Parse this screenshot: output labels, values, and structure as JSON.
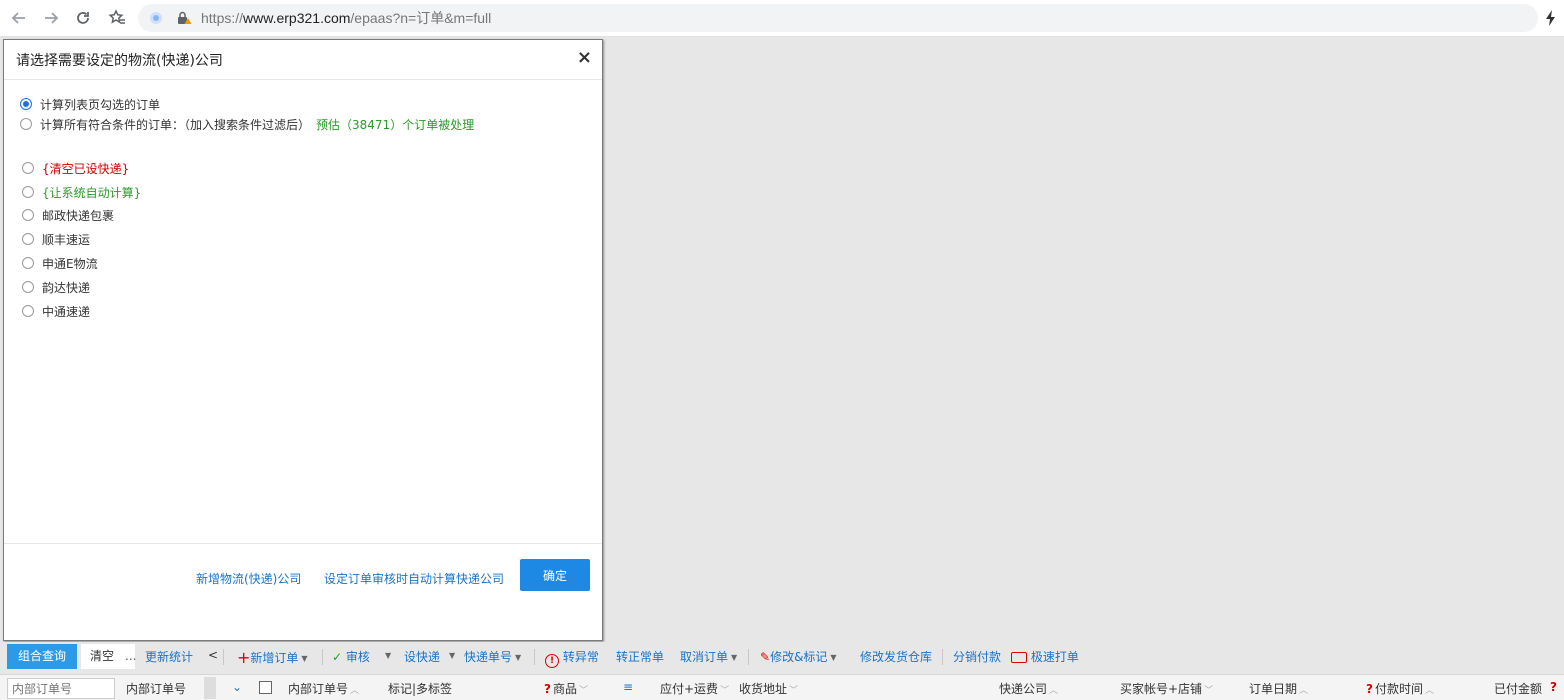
{
  "browser": {
    "url_prefix": "https://",
    "url_domain": "www.erp321.com",
    "url_path": "/epaas?n=订单&m=full"
  },
  "modal": {
    "title": "请选择需要设定的物流(快递)公司",
    "close_label": "×",
    "scope_options": [
      {
        "label": "计算列表页勾选的订单",
        "checked": true
      },
      {
        "label": "计算所有符合条件的订单：（加入搜索条件过滤后）",
        "hint": "预估（38471）个订单被处理",
        "checked": false
      }
    ],
    "carriers": [
      {
        "label": "{清空已设快递}",
        "color": "#d00000"
      },
      {
        "label": "{让系统自动计算}",
        "color": "#2a9b2a"
      },
      {
        "label": "邮政快递包裹"
      },
      {
        "label": "顺丰速运"
      },
      {
        "label": "申通E物流"
      },
      {
        "label": "韵达快递"
      },
      {
        "label": "中通速递"
      }
    ],
    "footer": {
      "add_carrier_link": "新增物流(快递)公司",
      "auto_calc_link": "设定订单审核时自动计算快递公司",
      "confirm_label": "确定"
    }
  },
  "toolbar": {
    "combo_query": "组合查询",
    "clear": "清空",
    "more": "...",
    "update_stats": "更新统计",
    "collapse": "<",
    "new_order": "新增订单",
    "review": "审核",
    "set_express": "设快递",
    "tracking_no": "快递单号",
    "to_abnormal": "转异常",
    "to_normal": "转正常单",
    "cancel_order": "取消订单",
    "modify_mark": "修改&标记",
    "modify_warehouse": "修改发货仓库",
    "dist_pay": "分销付款",
    "fast_print": "极速打单",
    "accent_color": "#2b9be8",
    "link_color": "#1a73c8"
  },
  "table": {
    "search_placeholder": "内部订单号",
    "search_label": "内部订单号",
    "columns": [
      {
        "label": "内部订单号",
        "sort": true
      },
      {
        "label": "标记|多标签"
      },
      {
        "label": "商品",
        "help": true,
        "sort": true
      },
      {
        "label": "≡"
      },
      {
        "label": "应付+运费",
        "sort": true
      },
      {
        "label": "收货地址",
        "sort": true
      },
      {
        "label": "快递公司",
        "sort": true
      },
      {
        "label": "买家帐号+店铺",
        "sort": true
      },
      {
        "label": "订单日期",
        "sort": true
      },
      {
        "label": "付款时间",
        "help": true,
        "sort": true
      },
      {
        "label": "已付金额"
      }
    ]
  }
}
